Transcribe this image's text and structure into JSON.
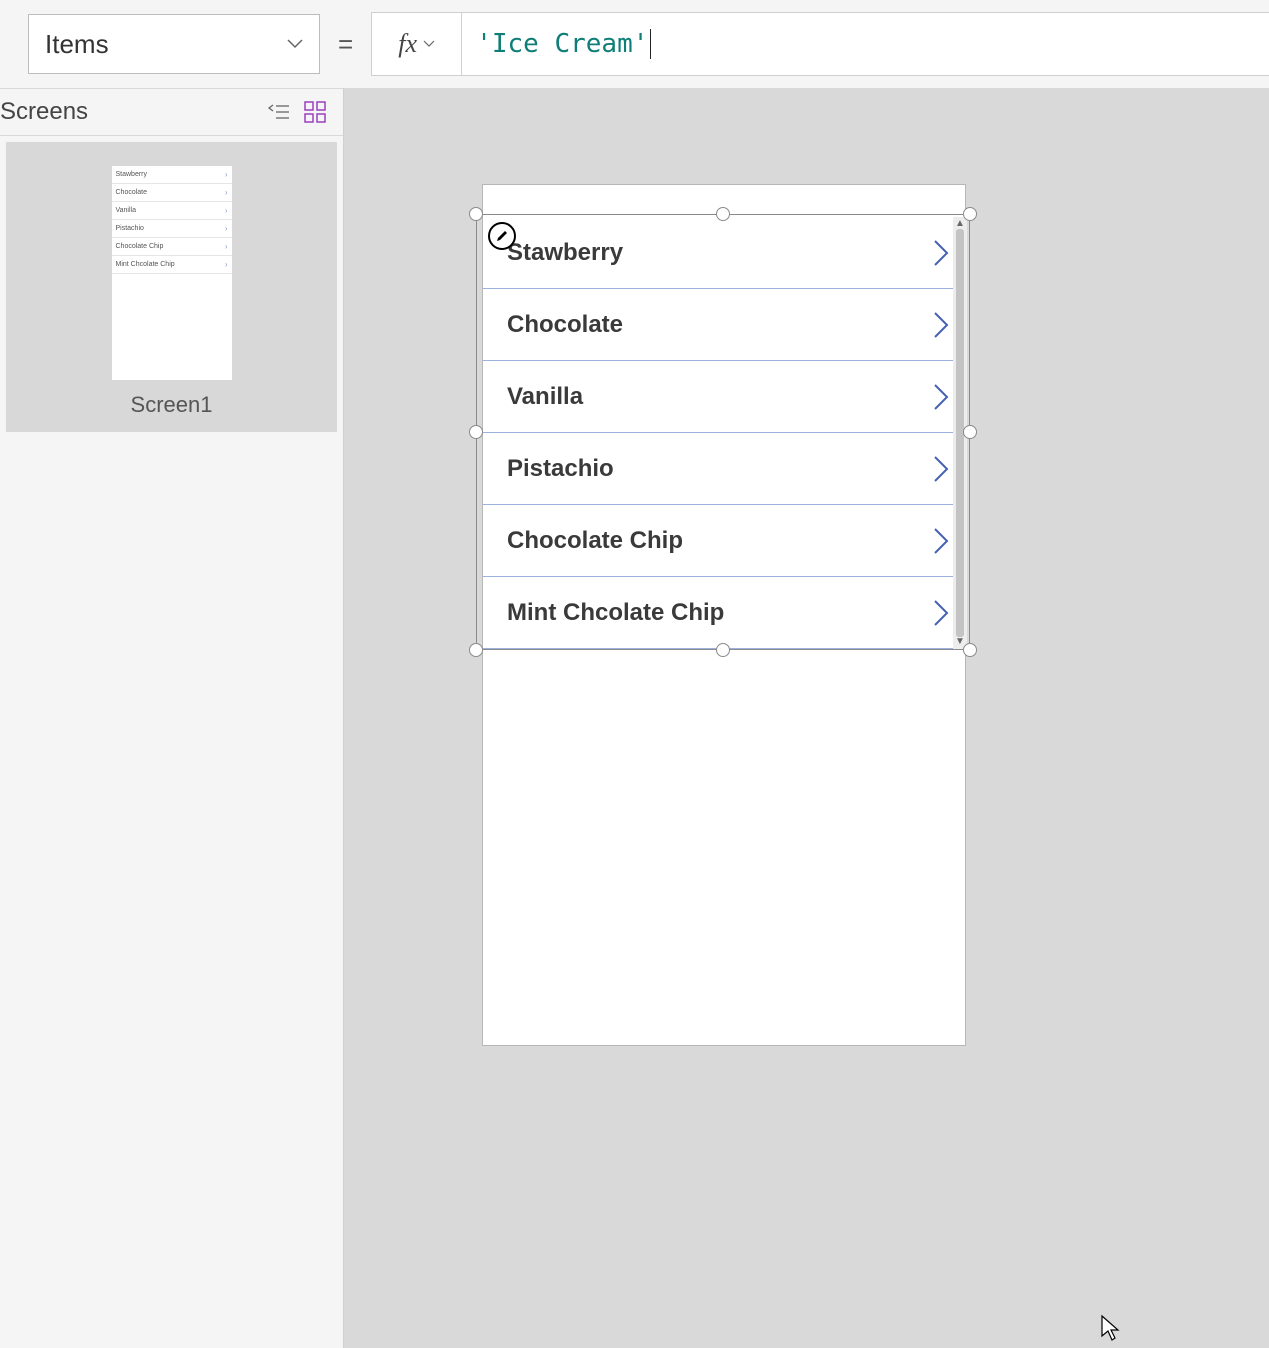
{
  "formulaBar": {
    "property": "Items",
    "fxLabel": "fx",
    "formula": "'Ice Cream'"
  },
  "tree": {
    "title": "Screens",
    "screenLabel": "Screen1"
  },
  "gallery": {
    "items": [
      {
        "label": "Stawberry"
      },
      {
        "label": "Chocolate"
      },
      {
        "label": "Vanilla"
      },
      {
        "label": "Pistachio"
      },
      {
        "label": "Chocolate Chip"
      },
      {
        "label": "Mint Chcolate Chip"
      }
    ]
  },
  "thumbItems": [
    "Stawberry",
    "Chocolate",
    "Vanilla",
    "Pistachio",
    "Chocolate Chip",
    "Mint Chcolate Chip"
  ]
}
